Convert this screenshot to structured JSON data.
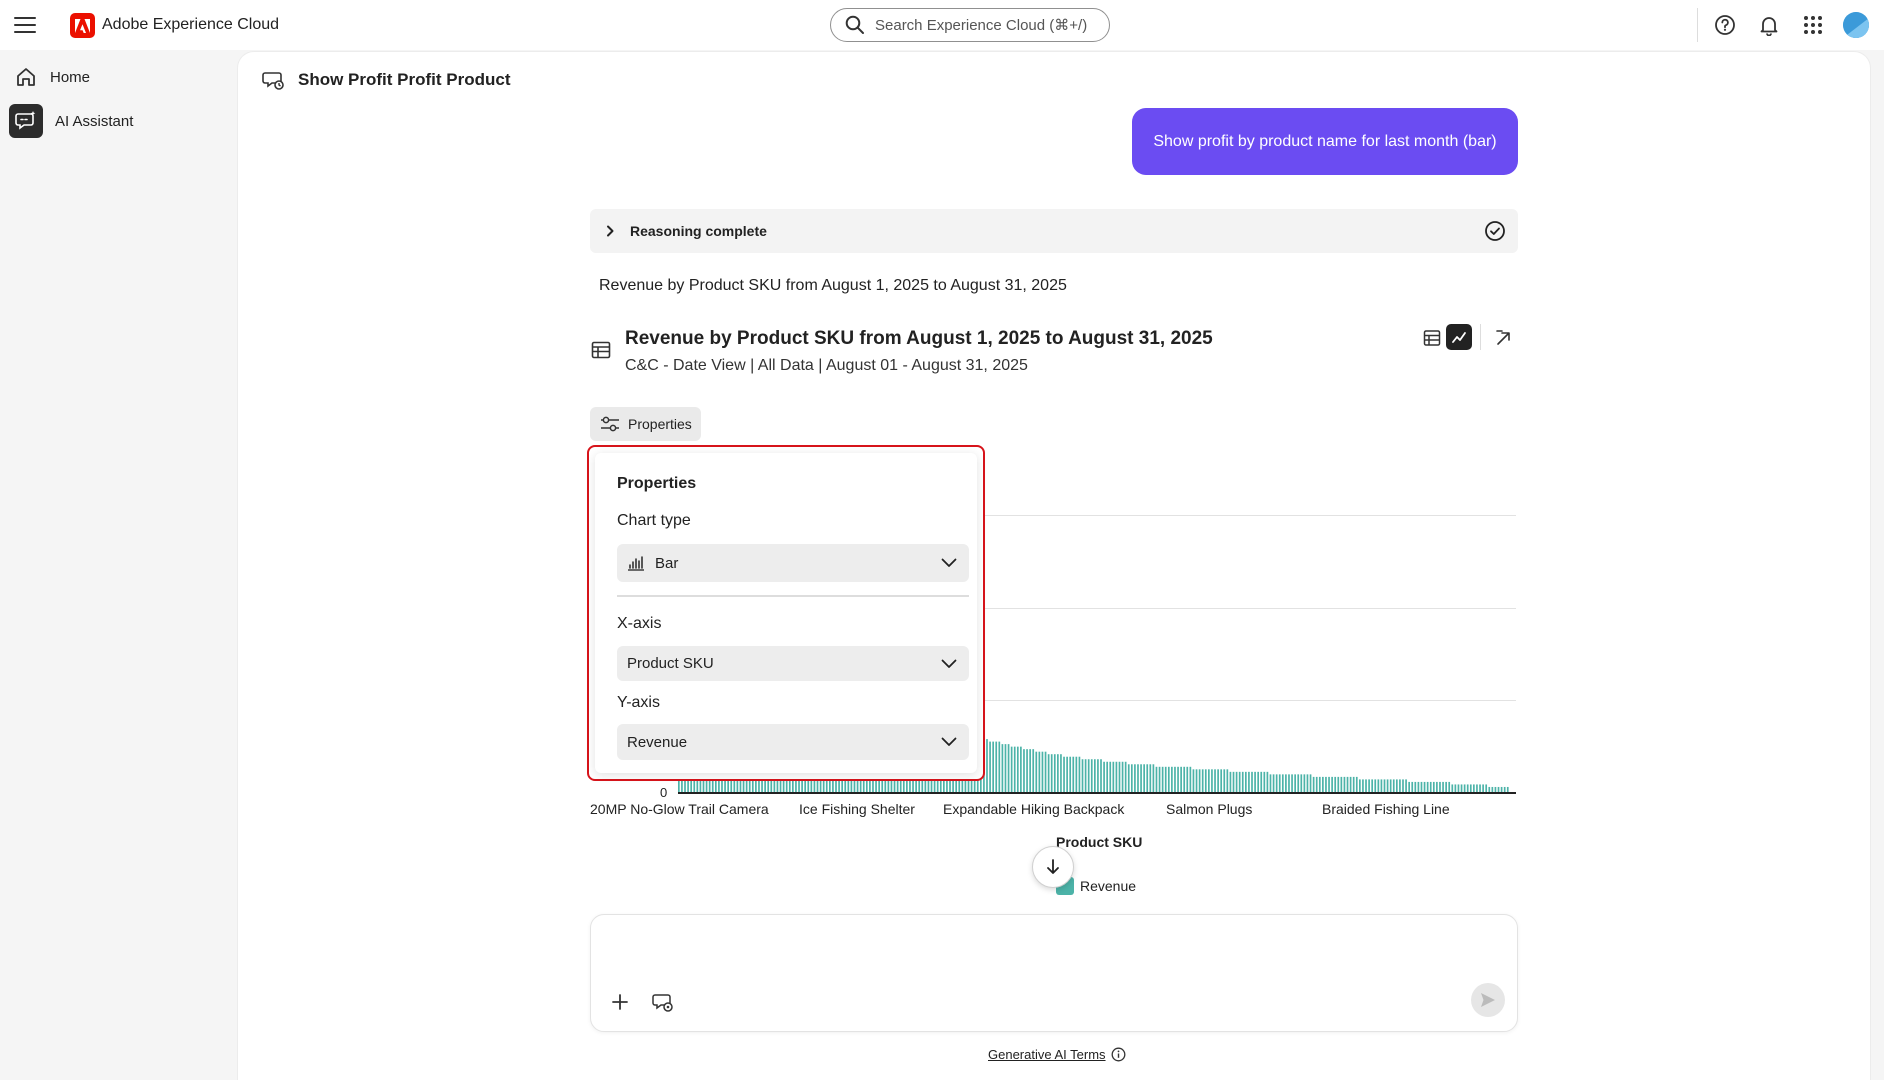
{
  "header": {
    "app_name": "Adobe Experience Cloud",
    "search_placeholder": "Search Experience Cloud (⌘+/)",
    "icons": [
      "menu-icon",
      "adobe-logo-icon",
      "search-icon",
      "help-icon",
      "bell-icon",
      "apps-grid-icon",
      "avatar"
    ]
  },
  "sidebar": {
    "items": [
      {
        "label": "Home",
        "icon": "home-icon"
      },
      {
        "label": "AI Assistant",
        "icon": "ai-assistant-icon"
      }
    ]
  },
  "main": {
    "title": "Show Profit Profit Product",
    "user_prompt": "Show profit by product name for last month (bar)",
    "reasoning_label": "Reasoning complete",
    "summary": "Revenue by Product SKU from August 1, 2025 to August 31, 2025",
    "chart_title": "Revenue by Product SKU from August 1, 2025 to August 31, 2025",
    "chart_subtitle": "C&C - Date View | All Data | August 01 - August 31, 2025",
    "properties_button": "Properties"
  },
  "properties_panel": {
    "heading": "Properties",
    "chart_type_label": "Chart type",
    "chart_type_value": "Bar",
    "x_axis_label": "X-axis",
    "x_axis_value": "Product SKU",
    "y_axis_label": "Y-axis",
    "y_axis_value": "Revenue"
  },
  "chart_data": {
    "type": "bar",
    "xlabel": "Product SKU",
    "ylabel": "",
    "zero_label": "0",
    "tick_labels": [
      "20MP No-Glow Trail Camera",
      "Ice Fishing Shelter",
      "Expandable Hiking Backpack",
      "Salmon Plugs",
      "Braided Fishing Line"
    ],
    "legend": [
      "Revenue"
    ],
    "series_color": "#4cb3a8",
    "visible_relative_values": [
      0.1,
      0.1,
      0.1,
      0.1,
      0.1,
      0.1,
      0.1,
      0.1,
      0.1,
      0.1,
      0.1,
      0.1,
      0.1,
      0.1,
      0.1,
      0.1,
      0.1,
      0.1,
      0.1,
      0.1,
      0.1,
      0.1,
      0.1,
      0.1,
      0.1,
      0.1,
      0.1,
      0.1,
      0.1,
      0.1,
      0.1,
      0.1,
      0.1,
      0.1,
      0.1,
      0.1,
      0.1,
      0.1,
      0.1,
      0.1,
      0.1,
      0.1,
      0.1,
      0.1,
      0.1,
      0.1,
      0.1,
      0.1,
      0.1,
      0.1,
      0.1,
      0.1,
      0.1,
      0.1,
      0.1,
      0.1,
      0.1,
      0.1,
      0.1,
      0.1,
      0.1,
      0.1,
      0.1,
      0.1,
      0.1,
      0.1,
      0.1,
      0.1,
      0.1,
      0.1,
      0.1,
      0.1,
      0.1,
      0.1,
      0.1,
      0.1,
      0.1,
      0.1,
      0.1,
      0.1,
      0.1,
      0.1,
      0.1,
      0.1,
      0.1,
      0.27,
      0.26,
      0.26,
      0.25,
      0.25,
      0.24,
      0.24,
      0.24,
      0.23,
      0.23,
      0.23,
      0.22,
      0.22,
      0.22,
      0.21,
      0.21,
      0.2,
      0.2,
      0.2,
      0.2,
      0.19,
      0.19,
      0.19,
      0.18,
      0.18,
      0.18,
      0.18,
      0.17,
      0.17,
      0.17,
      0.17,
      0.16,
      0.16,
      0.16,
      0.16,
      0.15,
      0.15,
      0.15,
      0.15,
      0.15,
      0.14,
      0.14,
      0.14,
      0.14,
      0.14,
      0.14,
      0.13,
      0.13,
      0.13,
      0.13,
      0.13,
      0.13,
      0.13,
      0.12,
      0.12,
      0.12,
      0.12,
      0.12,
      0.12,
      0.12,
      0.12,
      0.11,
      0.11,
      0.11,
      0.11,
      0.11,
      0.11,
      0.11,
      0.11,
      0.11,
      0.1,
      0.1,
      0.1,
      0.1,
      0.1,
      0.1,
      0.1,
      0.1,
      0.1,
      0.1,
      0.1,
      0.1,
      0.09,
      0.09,
      0.09,
      0.09,
      0.09,
      0.09,
      0.09,
      0.09,
      0.09,
      0.09,
      0.09,
      0.09,
      0.08,
      0.08,
      0.08,
      0.08,
      0.08,
      0.08,
      0.08,
      0.08,
      0.08,
      0.08,
      0.08,
      0.08,
      0.08,
      0.07,
      0.07,
      0.07,
      0.07,
      0.07,
      0.07,
      0.07,
      0.07,
      0.07,
      0.07,
      0.07,
      0.07,
      0.07,
      0.07,
      0.06,
      0.06,
      0.06,
      0.06,
      0.06,
      0.06,
      0.06,
      0.06,
      0.06,
      0.06,
      0.06,
      0.06,
      0.06,
      0.06,
      0.06,
      0.05,
      0.05,
      0.05,
      0.05,
      0.05,
      0.05,
      0.05,
      0.05,
      0.05,
      0.05,
      0.05,
      0.05,
      0.05,
      0.05,
      0.05,
      0.05,
      0.04,
      0.04,
      0.04,
      0.04,
      0.04,
      0.04,
      0.04,
      0.04,
      0.04,
      0.04,
      0.04,
      0.04,
      0.04,
      0.04,
      0.03,
      0.03,
      0.03,
      0.03,
      0.03,
      0.03,
      0.03,
      0.03,
      0.03,
      0.03,
      0.03,
      0.03,
      0.02,
      0.02,
      0.02,
      0.02,
      0.02,
      0.02,
      0.02
    ]
  },
  "composer": {
    "placeholder": "",
    "terms_link": "Generative AI Terms"
  },
  "colors": {
    "accent": "#6b4cf2",
    "adobe_red": "#eb1000",
    "highlight_border": "#d7141b",
    "bar": "#4cb3a8"
  }
}
